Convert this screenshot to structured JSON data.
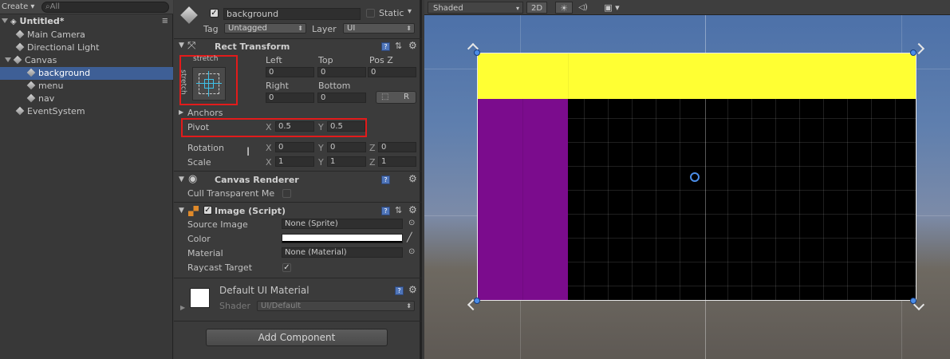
{
  "hierarchy": {
    "create_label": "Create",
    "search_placeholder": "All",
    "scene_name": "Untitled*",
    "items": [
      {
        "label": "Main Camera"
      },
      {
        "label": "Directional Light"
      },
      {
        "label": "Canvas"
      },
      {
        "label": "background"
      },
      {
        "label": "menu"
      },
      {
        "label": "nav"
      },
      {
        "label": "EventSystem"
      }
    ]
  },
  "inspector": {
    "object_name": "background",
    "static_label": "Static",
    "tag_label": "Tag",
    "tag_value": "Untagged",
    "layer_label": "Layer",
    "layer_value": "UI",
    "rect_transform": {
      "title": "Rect Transform",
      "stretch_h": "stretch",
      "stretch_v": "stretch",
      "left_label": "Left",
      "left_value": "0",
      "top_label": "Top",
      "top_value": "0",
      "posz_label": "Pos Z",
      "posz_value": "0",
      "right_label": "Right",
      "right_value": "0",
      "bottom_label": "Bottom",
      "bottom_value": "0",
      "r_button": "R",
      "anchors_label": "Anchors",
      "pivot_label": "Pivot",
      "pivot_x_label": "X",
      "pivot_x": "0.5",
      "pivot_y_label": "Y",
      "pivot_y": "0.5",
      "rotation_label": "Rotation",
      "rot_x": "0",
      "rot_y": "0",
      "rot_z": "0",
      "scale_label": "Scale",
      "scale_x": "1",
      "scale_y": "1",
      "scale_z": "1",
      "x_label": "X",
      "y_label": "Y",
      "z_label": "Z"
    },
    "canvas_renderer": {
      "title": "Canvas Renderer",
      "cull_label": "Cull Transparent Me"
    },
    "image": {
      "title": "Image (Script)",
      "source_label": "Source Image",
      "source_value": "None (Sprite)",
      "color_label": "Color",
      "material_label": "Material",
      "material_value": "None (Material)",
      "raycast_label": "Raycast Target"
    },
    "material": {
      "name": "Default UI Material",
      "shader_label": "Shader",
      "shader_value": "UI/Default"
    },
    "add_component": "Add Component"
  },
  "scene": {
    "shading_mode": "Shaded",
    "mode_2d": "2D"
  },
  "colors": {
    "selection": "#3e5f96",
    "yellow_panel": "#ffff33",
    "purple_panel": "#7b0c8d",
    "black_panel": "#000000",
    "highlight_box": "#e21b1b"
  }
}
